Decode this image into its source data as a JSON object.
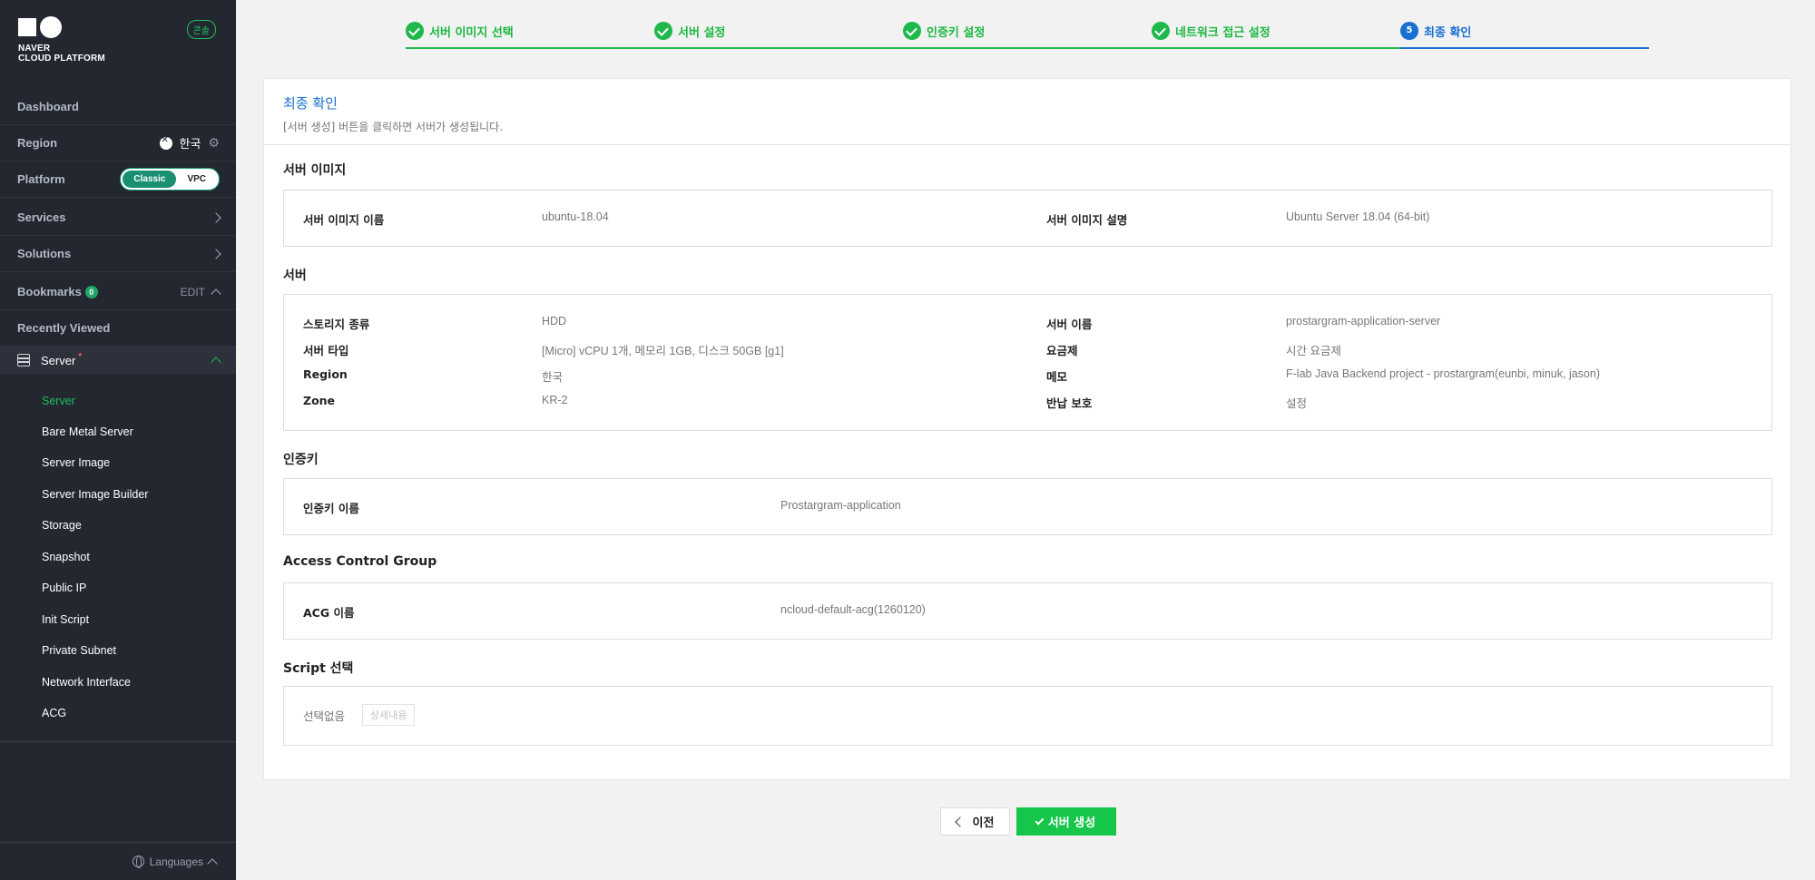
{
  "sidebar": {
    "brand_line1": "NAVER",
    "brand_line2": "CLOUD PLATFORM",
    "console_badge": "콘솔",
    "dashboard": "Dashboard",
    "region_label": "Region",
    "region_value": "한국",
    "platform_label": "Platform",
    "platform_options": [
      "Classic",
      "VPC"
    ],
    "platform_selected": "Classic",
    "services": "Services",
    "solutions": "Solutions",
    "bookmarks": "Bookmarks",
    "bookmarks_count": "0",
    "edit": "EDIT",
    "recently_viewed": "Recently Viewed",
    "server_group": "Server",
    "server_group_required_mark": "*",
    "items": [
      {
        "label": "Server",
        "active": true
      },
      {
        "label": "Bare Metal Server"
      },
      {
        "label": "Server Image"
      },
      {
        "label": "Server Image Builder"
      },
      {
        "label": "Storage"
      },
      {
        "label": "Snapshot"
      },
      {
        "label": "Public IP"
      },
      {
        "label": "Init Script"
      },
      {
        "label": "Private Subnet"
      },
      {
        "label": "Network Interface"
      },
      {
        "label": "ACG"
      }
    ],
    "languages": "Languages"
  },
  "stepper": {
    "steps": [
      {
        "label": "서버 이미지 선택",
        "state": "done"
      },
      {
        "label": "서버 설정",
        "state": "done"
      },
      {
        "label": "인증키 설정",
        "state": "done"
      },
      {
        "label": "네트워크 접근 설정",
        "state": "done"
      },
      {
        "label": "최종 확인",
        "state": "current",
        "number": "5"
      }
    ]
  },
  "card": {
    "title": "최종 확인",
    "subtitle": "[서버 생성] 버튼을 클릭하면 서버가 생성됩니다.",
    "server_image": {
      "title": "서버 이미지",
      "name_label": "서버 이미지 이름",
      "name_value": "ubuntu-18.04",
      "desc_label": "서버 이미지 설명",
      "desc_value": "Ubuntu Server 18.04 (64-bit)"
    },
    "server": {
      "title": "서버",
      "rows_left": [
        {
          "label": "스토리지 종류",
          "value": "HDD"
        },
        {
          "label": "서버 타입",
          "value": "[Micro] vCPU 1개, 메모리 1GB, 디스크 50GB [g1]"
        },
        {
          "label": "Region",
          "value": "한국"
        },
        {
          "label": "Zone",
          "value": "KR-2"
        }
      ],
      "rows_right": [
        {
          "label": "서버 이름",
          "value": "prostargram-application-server"
        },
        {
          "label": "요금제",
          "value": "시간 요금제"
        },
        {
          "label": "메모",
          "value": "F-lab Java Backend project - prostargram(eunbi, minuk, jason)"
        },
        {
          "label": "반납 보호",
          "value": "설정"
        }
      ]
    },
    "auth_key": {
      "title": "인증키",
      "label": "인증키 이름",
      "value": "Prostargram-application"
    },
    "acg": {
      "title": "Access Control Group",
      "label": "ACG 이름",
      "value": "ncloud-default-acg(1260120)"
    },
    "script": {
      "title": "Script 선택",
      "value": "선택없음",
      "detail_button": "상세내용"
    }
  },
  "footer": {
    "prev_label": "이전",
    "create_label": "서버 생성"
  },
  "colors": {
    "sidebar_bg": "#232730",
    "accent_green": "#16c64a",
    "accent_blue": "#1a6fd1"
  }
}
